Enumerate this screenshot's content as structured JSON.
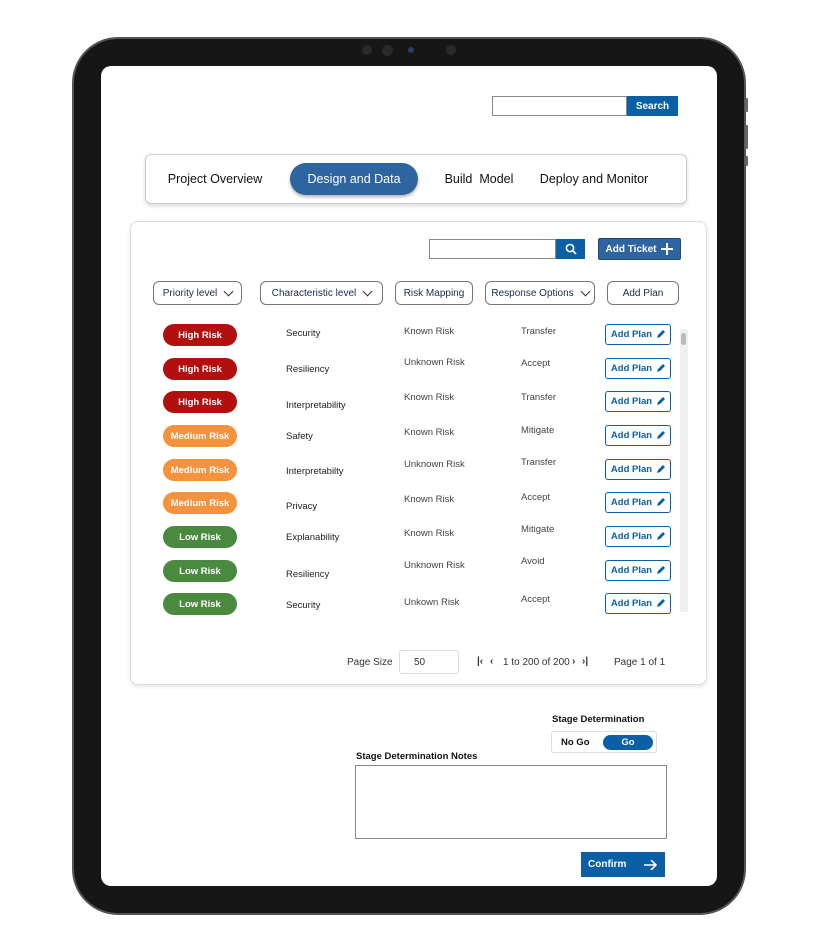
{
  "header": {
    "search_placeholder": "",
    "search_button": "Search"
  },
  "tabs": [
    {
      "label": "Project Overview"
    },
    {
      "label": "Design and Data",
      "active": true
    },
    {
      "label": "Build  Model"
    },
    {
      "label": "Deploy and Monitor"
    }
  ],
  "toolbar": {
    "add_ticket": "Add Ticket",
    "search_icon": "search-icon"
  },
  "filters": {
    "priority": "Priority level",
    "characteristic": "Characteristic level",
    "risk_mapping": "Risk Mapping",
    "response": "Response Options",
    "add_plan": "Add Plan"
  },
  "colors": {
    "high": "#b30f0f",
    "medium": "#f5923e",
    "low": "#4a8a3e",
    "primary": "#0b5fa5"
  },
  "rows": [
    {
      "risk": "High Risk",
      "level": "high",
      "characteristic": "Security",
      "mapping": "Known Risk",
      "response": "Transfer",
      "action": "Add Plan"
    },
    {
      "risk": "High Risk",
      "level": "high",
      "characteristic": "Resiliency",
      "mapping": "Unknown Risk",
      "response": "Accept",
      "action": "Add Plan"
    },
    {
      "risk": "High Risk",
      "level": "high",
      "characteristic": "Interpretability",
      "mapping": "Known Risk",
      "response": "Transfer",
      "action": "Add Plan"
    },
    {
      "risk": "Medium Risk",
      "level": "medium",
      "characteristic": "Safety",
      "mapping": "Known Risk",
      "response": "Mitigate",
      "action": "Add Plan"
    },
    {
      "risk": "Medium Risk",
      "level": "medium",
      "characteristic": "Interpretabilty",
      "mapping": "Unknown Risk",
      "response": "Transfer",
      "action": "Add Plan"
    },
    {
      "risk": "Medium Risk",
      "level": "medium",
      "characteristic": "Privacy",
      "mapping": "Known Risk",
      "response": "Accept",
      "action": "Add Plan"
    },
    {
      "risk": "Low Risk",
      "level": "low",
      "characteristic": "Explanability",
      "mapping": "Known Risk",
      "response": "Mitigate",
      "action": "Add Plan"
    },
    {
      "risk": "Low Risk",
      "level": "low",
      "characteristic": "Resiliency",
      "mapping": "Unknown Risk",
      "response": "Avoid",
      "action": "Add Plan"
    },
    {
      "risk": "Low Risk",
      "level": "low",
      "characteristic": "Security",
      "mapping": "Unkown Risk",
      "response": "Accept",
      "action": "Add Plan"
    }
  ],
  "pagination": {
    "page_size_label": "Page Size",
    "page_size": "50",
    "range": "1 to 200 of 200",
    "page": "Page 1 of 1"
  },
  "stage": {
    "label": "Stage Determination",
    "no_go": "No Go",
    "go": "Go",
    "selected": "Go",
    "notes_label": "Stage Determination Notes",
    "notes": "",
    "confirm": "Confirm"
  }
}
